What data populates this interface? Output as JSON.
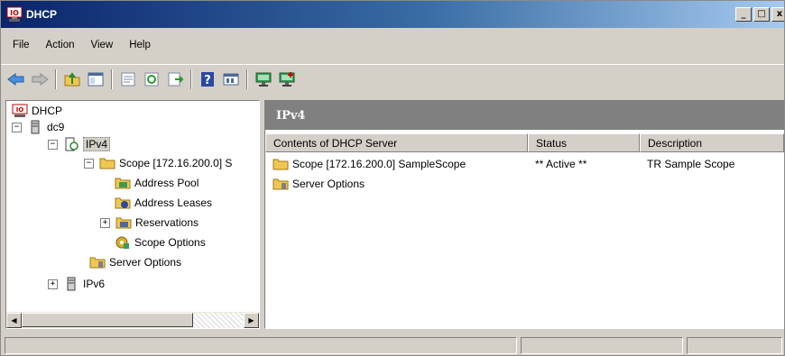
{
  "window": {
    "title": "DHCP"
  },
  "menu": [
    "File",
    "Action",
    "View",
    "Help"
  ],
  "toolbar": {
    "icons": [
      "back-arrow-icon",
      "forward-arrow-icon",
      "up-folder-icon",
      "show-hide-tree-icon",
      "properties-icon",
      "refresh-icon",
      "export-list-icon",
      "help-icon",
      "console-icon",
      "server-icon",
      "server-add-icon"
    ]
  },
  "tree": {
    "root": "DHCP",
    "server": "dc9",
    "ipv4": "IPv4",
    "scope": "Scope [172.16.200.0] S",
    "address_pool": "Address Pool",
    "address_leases": "Address Leases",
    "reservations": "Reservations",
    "scope_options": "Scope Options",
    "server_options": "Server Options",
    "ipv6": "IPv6"
  },
  "right_pane": {
    "header": "IPv4",
    "columns": [
      "Contents of DHCP Server",
      "Status",
      "Description"
    ],
    "rows": [
      {
        "name": "Scope [172.16.200.0] SampleScope",
        "status": "** Active **",
        "description": "TR Sample Scope"
      },
      {
        "name": "Server Options",
        "status": "",
        "description": ""
      }
    ]
  },
  "colors": {
    "title_gradient_start": "#0a246a",
    "pane_header": "#808080",
    "folder": "#f0c850"
  }
}
